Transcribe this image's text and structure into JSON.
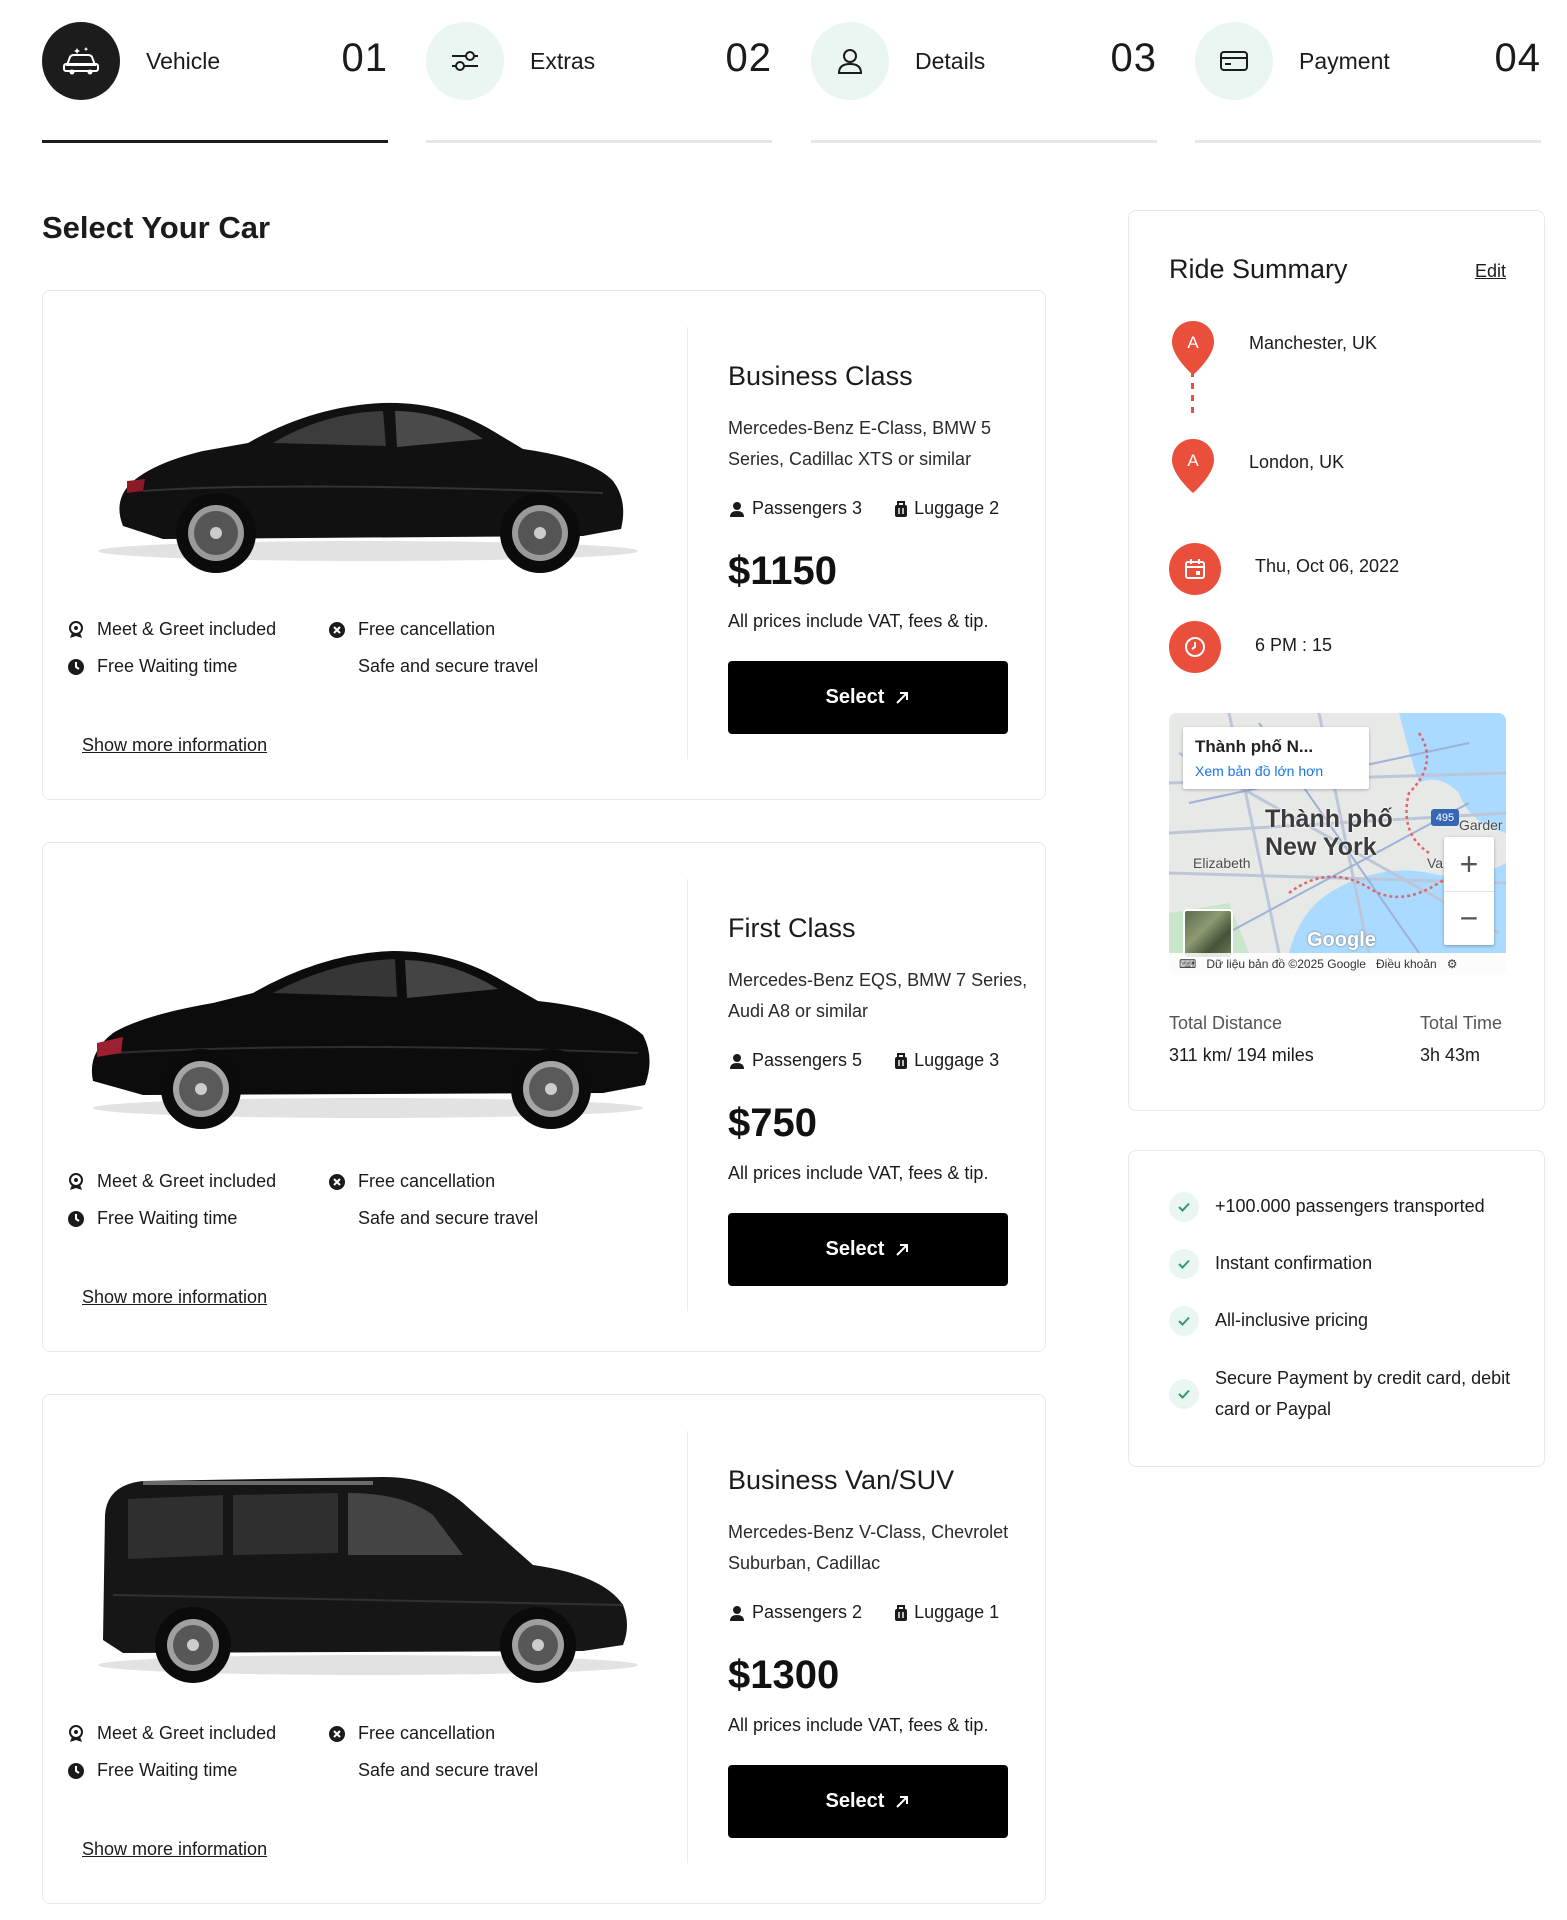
{
  "steps": [
    {
      "label": "Vehicle",
      "number": "01",
      "icon": "car-icon",
      "active": true
    },
    {
      "label": "Extras",
      "number": "02",
      "icon": "sliders-icon",
      "active": false
    },
    {
      "label": "Details",
      "number": "03",
      "icon": "users-icon",
      "active": false
    },
    {
      "label": "Payment",
      "number": "04",
      "icon": "credit-card-icon",
      "active": false
    }
  ],
  "page_title": "Select Your Car",
  "cars": [
    {
      "name": "Business Class",
      "models": "Mercedes-Benz E-Class, BMW 5 Series, Cadillac XTS or similar",
      "passengers": "Passengers 3",
      "luggage": "Luggage 2",
      "price": "$1150",
      "price_note": "All prices include VAT, fees & tip.",
      "select_label": "Select",
      "features": [
        "Meet & Greet included",
        "Free cancellation",
        "Free Waiting time",
        "Safe and secure travel"
      ],
      "more_label": "Show more information"
    },
    {
      "name": "First Class",
      "models": "Mercedes-Benz EQS, BMW 7 Series, Audi A8 or similar",
      "passengers": "Passengers 5",
      "luggage": "Luggage 3",
      "price": "$750",
      "price_note": "All prices include VAT, fees & tip.",
      "select_label": "Select",
      "features": [
        "Meet & Greet included",
        "Free cancellation",
        "Free Waiting time",
        "Safe and secure travel"
      ],
      "more_label": "Show more information"
    },
    {
      "name": "Business Van/SUV",
      "models": "Mercedes-Benz V-Class, Chevrolet Suburban, Cadillac",
      "passengers": "Passengers 2",
      "luggage": "Luggage 1",
      "price": "$1300",
      "price_note": "All prices include VAT, fees & tip.",
      "select_label": "Select",
      "features": [
        "Meet & Greet included",
        "Free cancellation",
        "Free Waiting time",
        "Safe and secure travel"
      ],
      "more_label": "Show more information"
    }
  ],
  "summary": {
    "title": "Ride Summary",
    "edit_label": "Edit",
    "pickup_marker": "A",
    "pickup": "Manchester, UK",
    "dropoff_marker": "A",
    "dropoff": "London, UK",
    "date": "Thu, Oct 06, 2022",
    "time": "6 PM : 15",
    "map": {
      "place_title": "Thành phố N...",
      "larger_map_link": "Xem bản đồ lớn hơn",
      "city_line1": "Thành phố",
      "city_line2": "New York",
      "label_elizabeth": "Elizabeth",
      "label_garden": "Garder",
      "label_val": "Val",
      "route_badge": "495",
      "zoom_in": "+",
      "zoom_out": "−",
      "google": "Google",
      "attribution": "Dữ liệu bản đồ ©2025 Google",
      "terms": "Điều khoản"
    },
    "distance_label": "Total Distance",
    "distance_value": "311 km/ 194 miles",
    "time_label": "Total Time",
    "time_value": "3h 43m"
  },
  "benefits": [
    "+100.000 passengers transported",
    "Instant confirmation",
    "All-inclusive pricing",
    "Secure Payment by credit card, debit card or Paypal"
  ],
  "colors": {
    "accent_red": "#ea4f3b",
    "mint": "#eaf6f1",
    "dark": "#1c1c1c",
    "check_green": "#2e9d6a"
  }
}
